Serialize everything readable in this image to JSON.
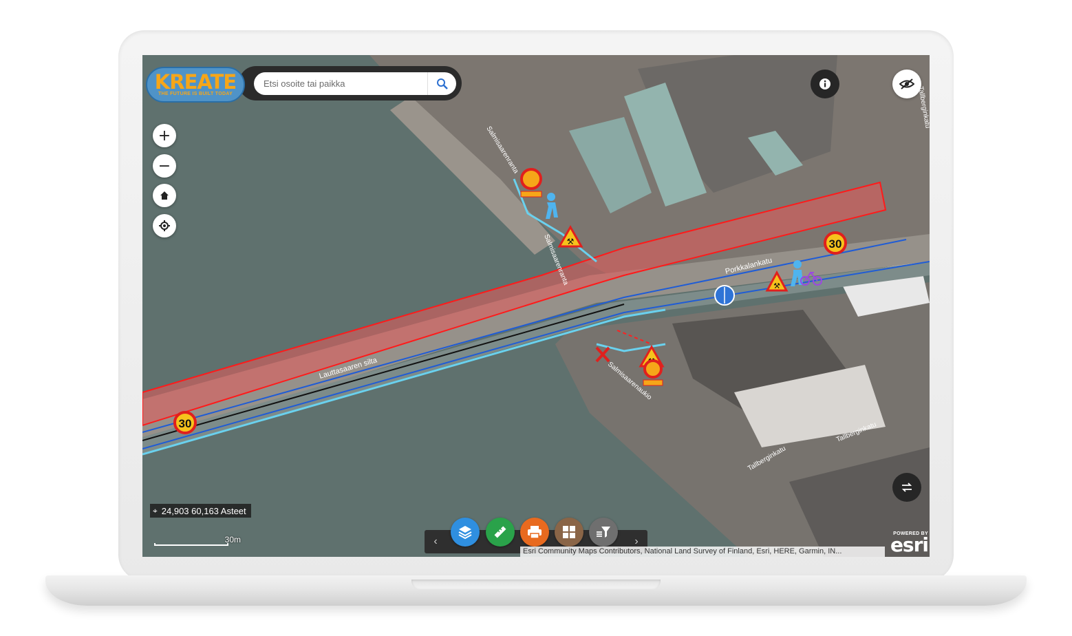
{
  "branding": {
    "logo_wordmark": "KREATE",
    "logo_tagline": "THE FUTURE IS BUILT TODAY"
  },
  "search": {
    "placeholder": "Etsi osoite tai paikka",
    "button_icon": "search-icon"
  },
  "map_controls": {
    "zoom_in": "+",
    "zoom_out": "−",
    "home_icon": "home-icon",
    "locate_icon": "locate-icon"
  },
  "top_right": {
    "info_icon": "info-icon",
    "visibility_icon": "eye-off-icon"
  },
  "coordinates": {
    "value": "24,903 60,163 Asteet"
  },
  "scale": {
    "label": "30m"
  },
  "street_labels": {
    "perkkalankatu": "Porkkalankatu",
    "lauttasaaren_silta": "Lauttasaaren silta",
    "tallberginkatu_1": "Tallberginkatu",
    "tallberginkatu_2": "Tallberginkatu",
    "salmisaarenranta": "Salmisaarenranta",
    "salmisaarenranta_2": "Salmisaarenranta",
    "salmisaarenaukio": "Salmisaarenaukio",
    "tallberginkatu_3": "Tallberginkatu"
  },
  "speed_signs": [
    "30",
    "30"
  ],
  "toolbar": {
    "prev": "‹",
    "next": "›",
    "buttons": [
      {
        "name": "layers",
        "icon": "layers-icon",
        "color": "#2f8fe0"
      },
      {
        "name": "measure",
        "icon": "ruler-icon",
        "color": "#2aa24a"
      },
      {
        "name": "print",
        "icon": "print-icon",
        "color": "#e86a1f"
      },
      {
        "name": "basemap",
        "icon": "grid-icon",
        "color": "#8a6547"
      },
      {
        "name": "filter",
        "icon": "filter-icon",
        "color": "#6f6f6f"
      }
    ]
  },
  "attribution": "Esri Community Maps Contributors, National Land Survey of Finland, Esri, HERE, Garmin, IN...",
  "esri": {
    "powered_by": "POWERED BY",
    "name": "esri"
  },
  "colors": {
    "work_zone_fill": "#e85a5a",
    "work_zone_stroke": "#ff1a1a",
    "bike_lane": "#1f5cd6",
    "walk_lane": "#6ad1ee",
    "accent": "#f6a619"
  }
}
